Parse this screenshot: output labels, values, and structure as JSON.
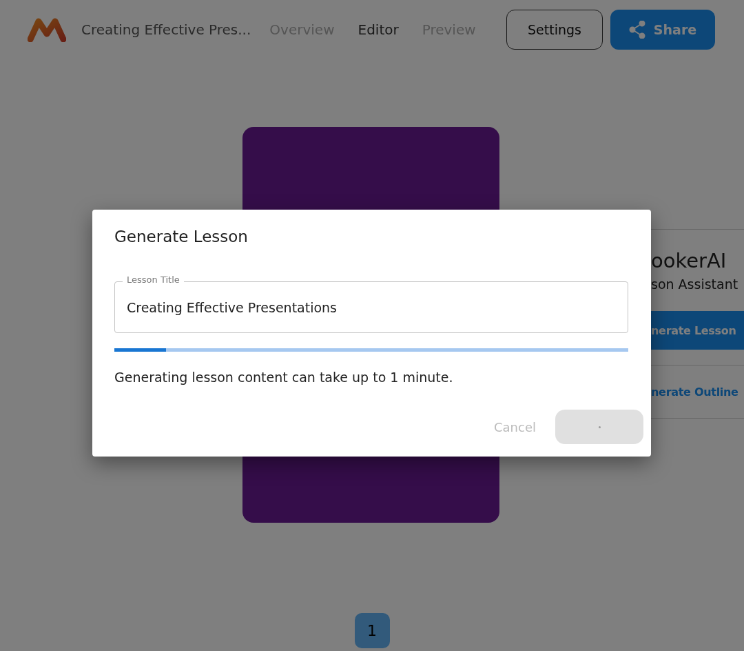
{
  "header": {
    "title": "Creating Effective Pres...",
    "tabs": [
      {
        "label": "Overview",
        "selected": false
      },
      {
        "label": "Editor",
        "selected": true
      },
      {
        "label": "Preview",
        "selected": false
      }
    ],
    "settings_button": "Settings",
    "share_button": "Share"
  },
  "side_panel": {
    "title": "ookerAI",
    "subtitle": "son Assistant",
    "primary_button": "nerate Lesson",
    "secondary_button": "nerate Outline"
  },
  "pagination": [
    {
      "label": "1",
      "selected": true
    }
  ],
  "dialog": {
    "title": "Generate Lesson",
    "field": {
      "label": "Lesson Title",
      "value": "Creating Effective Presentations"
    },
    "progress": {
      "level": 0.1
    },
    "message": "Generating lesson content can take up to 1 minute.",
    "cancel_button": {
      "label": "Cancel",
      "disabled": true
    },
    "confirm_button": {
      "disabled": true
    }
  }
}
